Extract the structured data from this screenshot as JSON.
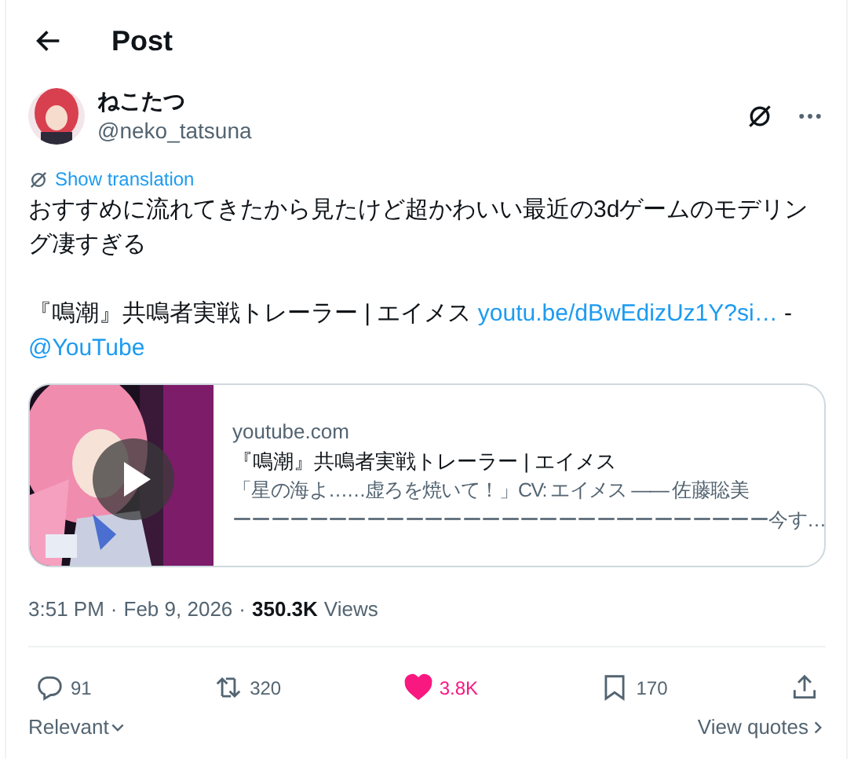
{
  "header": {
    "title": "Post"
  },
  "author": {
    "name": "ねこたつ",
    "handle": "@neko_tatsuna"
  },
  "translate_link": "Show translation",
  "body": [
    {
      "kind": "text",
      "text": "おすすめに流れてきたから見たけど超かわいい最近の3dゲームのモデリング凄すぎる"
    },
    {
      "kind": "break"
    },
    {
      "kind": "text",
      "text": "『鳴潮』共鳴者実戦トレーラー | エイメス "
    },
    {
      "kind": "link",
      "text": "youtu.be/dBwEdizUz1Y?si…"
    },
    {
      "kind": "text",
      "text": " -"
    },
    {
      "kind": "link",
      "text": "@YouTube"
    }
  ],
  "card": {
    "domain": "youtube.com",
    "title": "『鳴潮』共鳴者実戦トレーラー | エイメス",
    "description_lines": [
      "「星の海よ……虚ろを焼いて！」CV: エイメス —— 佐藤聡美",
      "ーーーーーーーーーーーーーーーーーーーーーーーーーーーー今す…"
    ]
  },
  "meta": {
    "time": "3:51 PM",
    "separator": "·",
    "date": "Feb 9, 2026",
    "views_count": "350.3K",
    "views_label": "Views"
  },
  "actions": [
    {
      "kind": "reply",
      "count": "91",
      "selected": false
    },
    {
      "kind": "repost",
      "count": "320",
      "selected": false
    },
    {
      "kind": "like",
      "count": "3.8K",
      "selected": true
    },
    {
      "kind": "bookmark",
      "count": "170",
      "selected": false
    },
    {
      "kind": "share"
    }
  ],
  "sort": {
    "label": "Relevant"
  },
  "quotes_link": "View quotes"
}
